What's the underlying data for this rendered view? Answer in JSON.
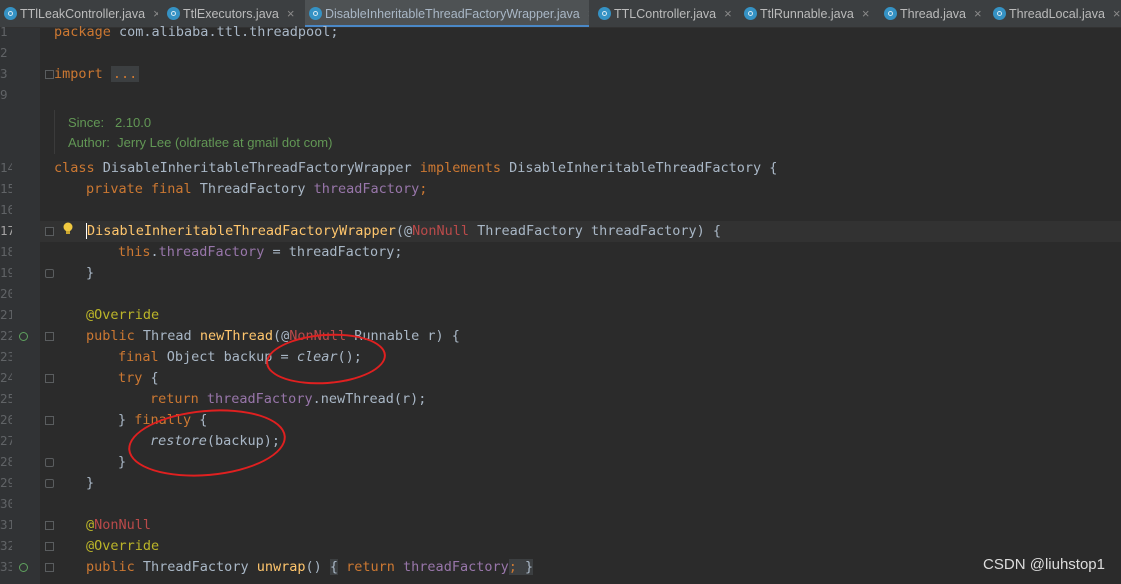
{
  "tabs": [
    {
      "label": "TTlLeakController.java",
      "close": "×",
      "icon": "java-class-icon"
    },
    {
      "label": "TtlExecutors.java",
      "close": "×",
      "icon": "java-class-icon"
    },
    {
      "label": "DisableInheritableThreadFactoryWrapper.java",
      "close": "×",
      "icon": "java-class-icon",
      "active": true
    },
    {
      "label": "TTLController.java",
      "close": "×",
      "icon": "java-class-icon"
    },
    {
      "label": "TtlRunnable.java",
      "close": "×",
      "icon": "java-class-icon"
    },
    {
      "label": "Thread.java",
      "close": "×",
      "icon": "java-class-icon"
    },
    {
      "label": "ThreadLocal.java",
      "close": "×",
      "icon": "java-class-icon"
    }
  ],
  "line_numbers": [
    "1",
    "2",
    "3",
    "9",
    "14",
    "15",
    "16",
    "17",
    "18",
    "19",
    "20",
    "21",
    "22",
    "23",
    "24",
    "25",
    "26",
    "27",
    "28",
    "29",
    "30",
    "31",
    "32",
    "33"
  ],
  "code": {
    "l1_kw": "package",
    "l1_rest": " com.alibaba.ttl.threadpool;",
    "l3_kw": "import",
    "l3_fold": "...",
    "doc_since_label": "Since:",
    "doc_since_value": "2.10.0",
    "doc_author_label": "Author:",
    "doc_author_value": "Jerry Lee (oldratlee at gmail dot com)",
    "l14_kw1": "class",
    "l14_name": " DisableInheritableThreadFactoryWrapper ",
    "l14_kw2": "implements",
    "l14_rest": " DisableInheritableThreadFactory {",
    "l15_kw": "private final",
    "l15_type": " ThreadFactory ",
    "l15_field": "threadFactory",
    "l15_semi": ";",
    "l17_name_first": "D",
    "l17_name_rest": "isableInheritableThreadFactoryWrapper",
    "l17_p1": "(@",
    "l17_nn": "NonNull",
    "l17_rest": " ThreadFactory threadFactory) {",
    "l18_this": "this",
    "l18_dot": ".",
    "l18_field": "threadFactory",
    "l18_rest": " = threadFactory;",
    "l19": "}",
    "l21_ann": "@Override",
    "l22_kw": "public",
    "l22_type": " Thread ",
    "l22_fn": "newThread",
    "l22_p1": "(@",
    "l22_nn": "NonNull",
    "l22_rest": " Runnable r) {",
    "l23_kw": "final",
    "l23_rest": " Object backup = ",
    "l23_fn": "clear",
    "l23_end": "();",
    "l24_kw": "try",
    "l24_rest": " {",
    "l25_kw": "return",
    "l25_field": " threadFactory",
    "l25_rest": ".newThread(r);",
    "l26_p1": "} ",
    "l26_kw": "finally",
    "l26_rest": " {",
    "l27_fn": "restore",
    "l27_rest": "(backup);",
    "l28": "}",
    "l29": "}",
    "l31_at": "@",
    "l31_nn": "NonNull",
    "l32_ann": "@Override",
    "l33_kw": "public",
    "l33_type": " ThreadFactory ",
    "l33_fn": "unwrap",
    "l33_p": "() ",
    "l33_b1": "{",
    "l33_kw2": " return",
    "l33_field": " threadFactory",
    "l33_semi": ";",
    "l33_b2": " }"
  },
  "watermark": "CSDN @liuhstop1",
  "colors": {
    "keyword": "#cc7832",
    "field": "#9876aa",
    "annotation": "#bbb529",
    "method": "#ffc66d",
    "nonnull": "#ba4a4a",
    "doc": "#629755",
    "circle": "#e02020"
  }
}
